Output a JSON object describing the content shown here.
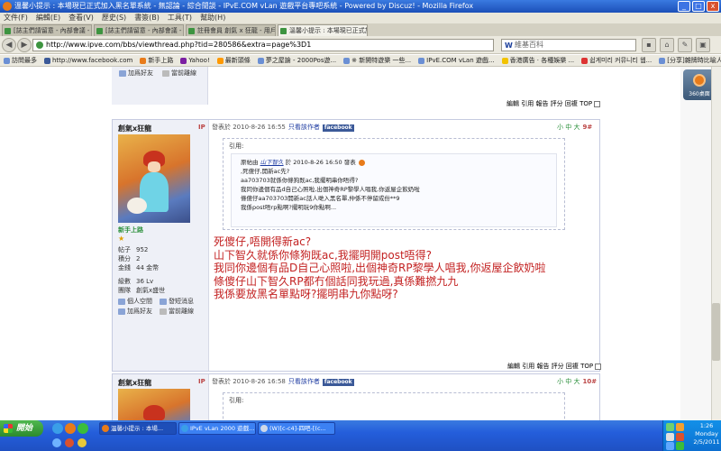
{
  "window": {
    "title": "溫馨小提示 : 本場現已正式加入黑名單系統 - 無認論 - 綜合閒談 - IPvE.COM vLan 遊戲平台專吧系統 - Powered by Discuz! - Mozilla Firefox",
    "minimize": "_",
    "maximize": "□",
    "close": "x"
  },
  "menubar": [
    "文件(F)",
    "編輯(E)",
    "查看(V)",
    "歷史(S)",
    "書簽(B)",
    "工具(T)",
    "幫助(H)"
  ],
  "tabs": [
    {
      "label": "[誌主們請留意 - 內部會議 - IPvE.COM ..."
    },
    {
      "label": "[誌主們請留意 - 內部會議 - IPvE.COM ..."
    },
    {
      "label": "註冊會員 創氣 x 狂龍 - 用戶申請 : 計..."
    },
    {
      "label": "溫馨小提示 : 本場現已正式加入黑名..."
    }
  ],
  "nav": {
    "back": "◀",
    "forward": "▶",
    "url": "http://www.ipve.com/bbs/viewthread.php?tid=280586&extra=page%3D1",
    "search_engine": "W",
    "search_placeholder": "維基百科"
  },
  "bookmarks": [
    "訪問最多",
    "http://www.facebook.com",
    "新手上路",
    "Yahoo!",
    "最新頭條",
    "夢之屋論 - 2000Pos遊...",
    "※ 新開特遊樂 一些...",
    "IPvE.COM vLan 遊戲...",
    "香港廣告 · 各種娛樂 ...",
    "쉽게미리 커뮤니티 웹...",
    "[分享]雜牌時比喻人..."
  ],
  "widget": {
    "label": "360桌面"
  },
  "post1": {
    "add_friend": "加爲好友",
    "status": "當前離線",
    "tools": "編輯 引用 報告 評分 回複 TOP"
  },
  "post2": {
    "username": "創氣x狂龍",
    "ip_tag": "IP",
    "rank": "新手上路",
    "star": "★",
    "stats": [
      {
        "label": "帖子",
        "value": "952"
      },
      {
        "label": "積分",
        "value": "2"
      },
      {
        "label": "金錢",
        "value": "44 金幣"
      },
      {
        "label": "級數",
        "value": "36 Lv"
      },
      {
        "label": "團隊",
        "value": "創氣x盛世"
      }
    ],
    "links": [
      "個人空間",
      "發短消息",
      "加爲好友",
      "當前離線"
    ],
    "header": {
      "posted": "發表於 2010-8-26 16:55",
      "author_only": "只看該作者",
      "facebook": "facebook"
    },
    "floor_controls": "小 中 大",
    "floor_number": "9#",
    "quote_title": "引用:",
    "quote_lines": [
      {
        "prefix": "原帖由",
        "user": "山下智久",
        "suffix": "於 2010-8-26 16:50 發表"
      },
      {
        "text": ",死傻仔,開新ac先?"
      },
      {
        "text": "aa703703就係你條狗既ac,我擺明串你唔得?"
      },
      {
        "text": "我同你邊個有品d自己心照啦,出個神奇RP黎學人唱我,你返屋企飲奶啦"
      },
      {
        "text": "條傻仔aa703703開新ac話人哋入黑名單,仲係不停留成份**9"
      },
      {
        "text": "我係post唔rp點啊?擺明玩9你點啊..."
      }
    ],
    "reply_lines": [
      "死傻仔,唔開得新ac?",
      "山下智久就係你條狗既ac,我擺明開post唔得?",
      "我同你邊個有品D自己心照啦,出個神奇RP黎學人唱我,你返屋企飲奶啦",
      "條傻仔山下智久RP都冇個話同我玩過,真係難撚九九",
      "我係要放黑名單點呀?擺明串九你點呀?"
    ],
    "tools": "編輯 引用 報告 評分 回複 TOP"
  },
  "post3": {
    "username": "創氣x狂龍",
    "ip_tag": "IP",
    "header": {
      "posted": "發表於 2010-8-26 16:58",
      "author_only": "只看該作者",
      "facebook": "facebook"
    },
    "floor_controls": "小 中 大",
    "floor_number": "10#",
    "quote_title": "引用:"
  },
  "taskbar": {
    "start": "開始",
    "items": [
      {
        "label": "溫馨小提示 : 本場..."
      },
      {
        "label": "IPvE vLan 2000 遊戲..."
      },
      {
        "label": "(W)[c-c4]-四吧-[(c..."
      }
    ],
    "clock_time": "1:26",
    "clock_day": "Monday",
    "clock_date": "2/5/2011"
  },
  "colors": {
    "reply_red": "#c32222",
    "link_blue": "#1c3aa0",
    "rank_green": "#2a8f3a",
    "taskbar_blue": "#245edb"
  }
}
